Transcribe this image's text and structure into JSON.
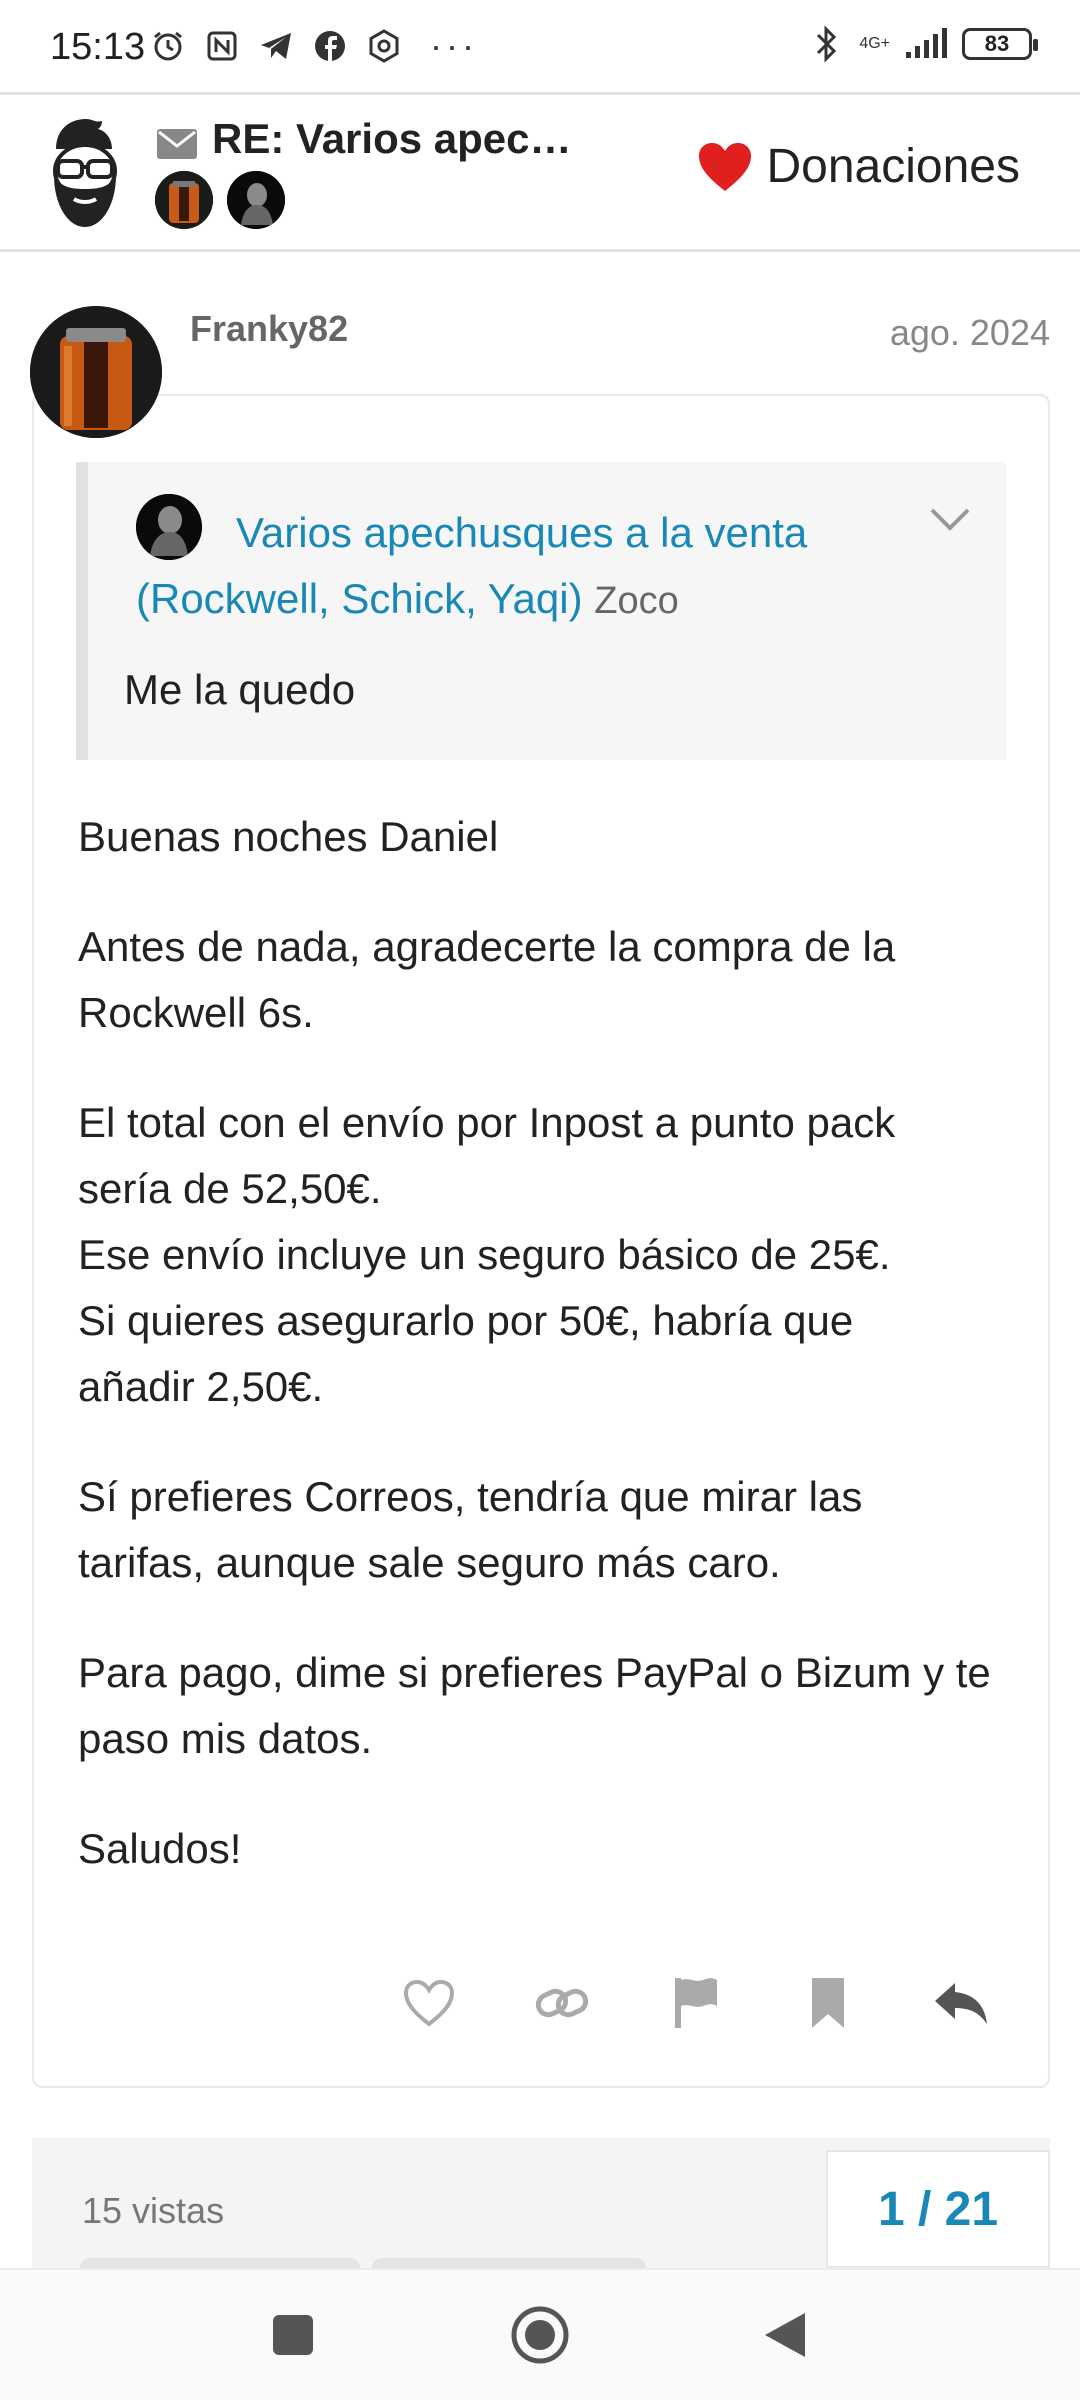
{
  "status_bar": {
    "time": "15:13",
    "battery": "83",
    "network": "4G+",
    "more": "···"
  },
  "header": {
    "topic_title": "RE: Varios apech…",
    "donate_label": "Donaciones"
  },
  "post": {
    "username": "Franky82",
    "date": "ago. 2024",
    "quote": {
      "title": "Varios apechusques a la venta (Rockwell, Schick, Yaqi)",
      "category": "Zoco",
      "body": "Me la quedo"
    },
    "paragraphs": [
      "Buenas noches Daniel",
      "Antes de nada, agradecerte la compra de la Rockwell 6s.",
      "El total con el envío por Inpost a punto pack sería de 52,50€.",
      "Ese envío incluye un seguro básico de 25€.",
      "Si quieres asegurarlo por 50€, habría que añadir 2,50€.",
      "Sí prefieres Correos, tendría que mirar las tarifas, aunque sale seguro más caro.",
      "Para pago, dime si prefieres PayPal o Bizum y te paso mis datos.",
      "Saludos!"
    ],
    "actions": [
      "heart-icon",
      "link-icon",
      "flag-icon",
      "bookmark-icon",
      "reply-icon"
    ]
  },
  "topic_footer": {
    "views": "15 vistas",
    "pager": "1 / 21"
  },
  "colors": {
    "link": "#1a88b6",
    "heart": "#e0201f"
  }
}
